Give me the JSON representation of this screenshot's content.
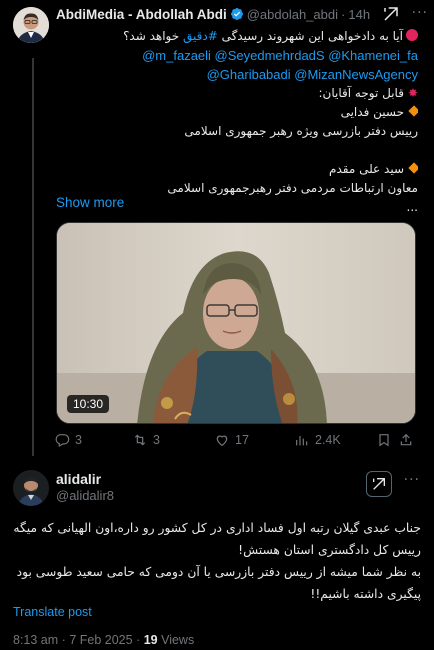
{
  "tweet1": {
    "author_name": "AbdiMedia - Abdollah Abdi",
    "handle": "@abdolah_abdi",
    "separator": "·",
    "time": "14h",
    "more_glyph": "···",
    "lines": [
      {
        "text": "آیا به دادخواهی این شهروند رسیدگی ",
        "tag": "#دقیق",
        "tail": " خواهد شد؟",
        "kind": "question"
      },
      {
        "mentions": "@m_fazaeli @SeyedmehrdadS @Khamenei_fa",
        "kind": "mentions"
      },
      {
        "mentions": "@Gharibabadi @MizanNewsAgency",
        "kind": "mentions"
      },
      {
        "text": "قابل توجه آقایان:",
        "kind": "heading"
      },
      {
        "text": "حسین فدایی",
        "kind": "bullet"
      },
      {
        "text": "رییس دفتر بازرسی ویژه رهبر جمهوری اسلامی",
        "kind": "plain"
      },
      {
        "text": "",
        "kind": "blank"
      },
      {
        "text": "سید علی مقدم",
        "kind": "bullet"
      },
      {
        "text": "معاون ارتباطات مردمی دفتر رهبرجمهوری اسلامی",
        "kind": "plain"
      },
      {
        "text": "...",
        "kind": "plain"
      }
    ],
    "show_more": "Show more",
    "video_duration": "10:30",
    "actions": {
      "replies": "3",
      "reposts": "3",
      "likes": "17",
      "views": "2.4K"
    }
  },
  "tweet2": {
    "author_name": "alidalir",
    "handle": "@alidalir8",
    "more_glyph": "···",
    "body_lines": [
      "جناب عبدی گیلان رتبه اول فساد اداری در کل کشور رو داره،اون الهیانی که میگه الان",
      "رییس کل دادگستری استان هستش!",
      "به نظر شما میشه از رییس دفتر بازرسی یا آن دومی که حامی سعید طوسی بود انتظار",
      "پیگیری داشته باشیم!!"
    ],
    "translate_label": "Translate post",
    "time": "8:13 am",
    "separator": "·",
    "date": "7 Feb 2025",
    "view_count": "19",
    "views_label": "Views"
  },
  "colors": {
    "background": "#000000",
    "text": "#e7e9ea",
    "muted": "#71767b",
    "link": "#1d9bf0",
    "verified": "#1d9bf0"
  },
  "icons": [
    "verified-badge-icon",
    "grok-icon",
    "more-icon",
    "reply-icon",
    "repost-icon",
    "like-icon",
    "views-icon",
    "bookmark-icon",
    "share-icon",
    "red-circle-icon",
    "sparkle-icon",
    "diamond-icon"
  ]
}
